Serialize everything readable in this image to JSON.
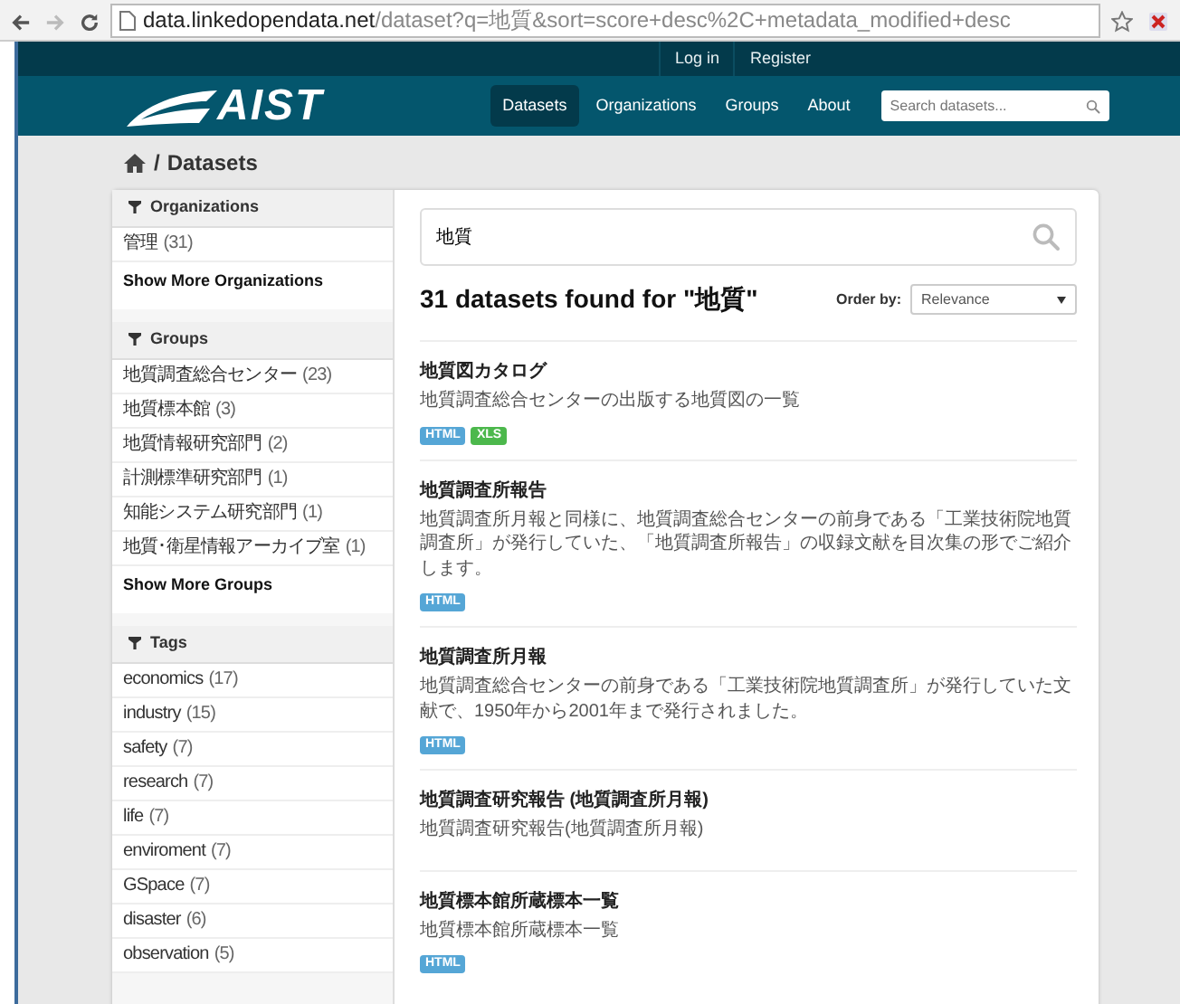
{
  "browser": {
    "url_host": "data.linkedopendata.net",
    "url_path": "/dataset?q=地質&sort=score+desc%2C+metadata_modified+desc"
  },
  "account_links": [
    {
      "label": "Log in"
    },
    {
      "label": "Register"
    }
  ],
  "nav": [
    {
      "label": "Datasets",
      "selected": true
    },
    {
      "label": "Organizations",
      "selected": false
    },
    {
      "label": "Groups",
      "selected": false
    },
    {
      "label": "About",
      "selected": false
    }
  ],
  "header_search": {
    "placeholder": "Search datasets..."
  },
  "logo": {
    "text": "AIST"
  },
  "breadcrumb": {
    "separator": "/",
    "current": "Datasets"
  },
  "facets": [
    {
      "title": "Organizations",
      "items": [
        {
          "label": "管理",
          "count": "(31)"
        }
      ],
      "more": "Show More Organizations"
    },
    {
      "title": "Groups",
      "items": [
        {
          "label": "地質調査総合センター",
          "count": "(23)"
        },
        {
          "label": "地質標本館",
          "count": "(3)"
        },
        {
          "label": "地質情報研究部門",
          "count": "(2)"
        },
        {
          "label": "計測標準研究部門",
          "count": "(1)"
        },
        {
          "label": "知能システム研究部門",
          "count": "(1)"
        },
        {
          "label": "地質･衛星情報アーカイブ室",
          "count": "(1)"
        }
      ],
      "more": "Show More Groups"
    },
    {
      "title": "Tags",
      "items": [
        {
          "label": "economics",
          "count": "(17)"
        },
        {
          "label": "industry",
          "count": "(15)"
        },
        {
          "label": "safety",
          "count": "(7)"
        },
        {
          "label": "research",
          "count": "(7)"
        },
        {
          "label": "life",
          "count": "(7)"
        },
        {
          "label": "enviroment",
          "count": "(7)"
        },
        {
          "label": "GSpace",
          "count": "(7)"
        },
        {
          "label": "disaster",
          "count": "(6)"
        },
        {
          "label": "observation",
          "count": "(5)"
        }
      ]
    }
  ],
  "search": {
    "value": "地質"
  },
  "results_heading": "31 datasets found for \"地質\"",
  "order_by": {
    "label": "Order by:",
    "value": "Relevance"
  },
  "datasets": [
    {
      "title": "地質図カタログ",
      "description": "地質調査総合センターの出版する地質図の一覧",
      "formats": [
        {
          "label": "HTML",
          "color": "#55a6d6"
        },
        {
          "label": "XLS",
          "color": "#4cb84c"
        }
      ]
    },
    {
      "title": "地質調査所報告",
      "description": "地質調査所月報と同様に、地質調査総合センターの前身である「工業技術院地質調査所」が発行していた、「地質調査所報告」の収録文献を目次集の形でご紹介します。",
      "formats": [
        {
          "label": "HTML",
          "color": "#55a6d6"
        }
      ]
    },
    {
      "title": "地質調査所月報",
      "description": "地質調査総合センターの前身である「工業技術院地質調査所」が発行していた文献で、1950年から2001年まで発行されました。",
      "formats": [
        {
          "label": "HTML",
          "color": "#55a6d6"
        }
      ]
    },
    {
      "title": "地質調査研究報告 (地質調査所月報)",
      "description": "地質調査研究報告(地質調査所月報)"
    },
    {
      "title": "地質標本館所蔵標本一覧",
      "description": "地質標本館所蔵標本一覧",
      "formats": [
        {
          "label": "HTML",
          "color": "#55a6d6"
        }
      ]
    }
  ]
}
